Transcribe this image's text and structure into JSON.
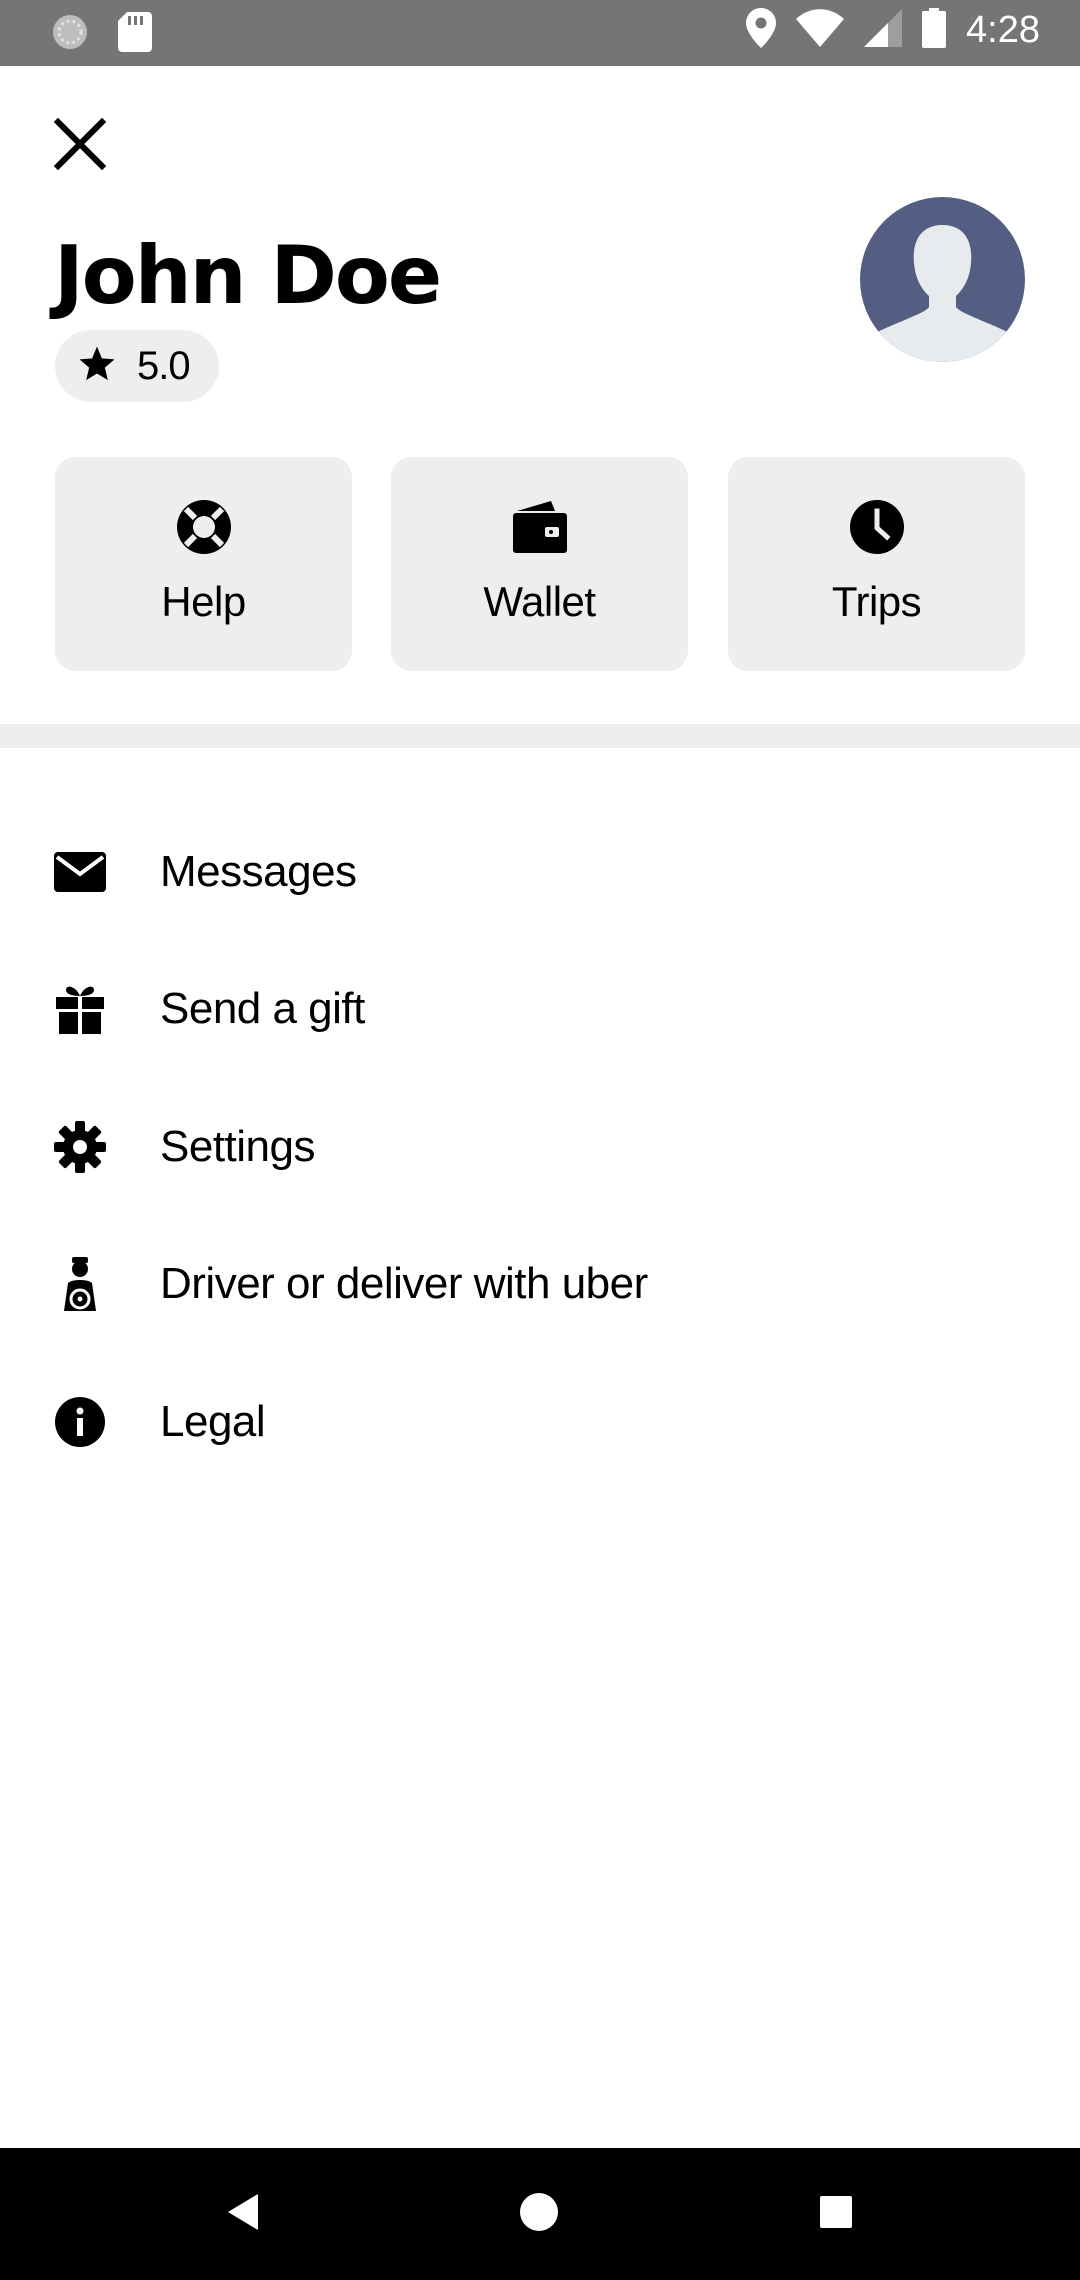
{
  "status_bar": {
    "time": "4:28",
    "icons": [
      "sync-icon",
      "sd-card-icon",
      "location-icon",
      "wifi-icon",
      "signal-icon",
      "battery-icon"
    ]
  },
  "header": {
    "close_icon": "close-icon"
  },
  "profile": {
    "name": "John Doe",
    "rating": "5.0",
    "rating_icon": "star-icon",
    "avatar_icon": "person-silhouette-icon"
  },
  "tiles": [
    {
      "label": "Help",
      "icon": "lifebuoy-icon"
    },
    {
      "label": "Wallet",
      "icon": "wallet-icon"
    },
    {
      "label": "Trips",
      "icon": "clock-icon"
    }
  ],
  "menu": [
    {
      "label": "Messages",
      "icon": "envelope-icon"
    },
    {
      "label": "Send a gift",
      "icon": "gift-icon"
    },
    {
      "label": "Settings",
      "icon": "gear-icon"
    },
    {
      "label": "Driver or deliver with uber",
      "icon": "driver-icon"
    },
    {
      "label": "Legal",
      "icon": "info-icon"
    }
  ],
  "nav_bar": {
    "icons": [
      "back-icon",
      "home-icon",
      "recents-icon"
    ]
  },
  "colors": {
    "status_bar": "#757575",
    "tile_background": "#eeeeee",
    "avatar_background": "#545e82",
    "nav_bar": "#000000"
  }
}
